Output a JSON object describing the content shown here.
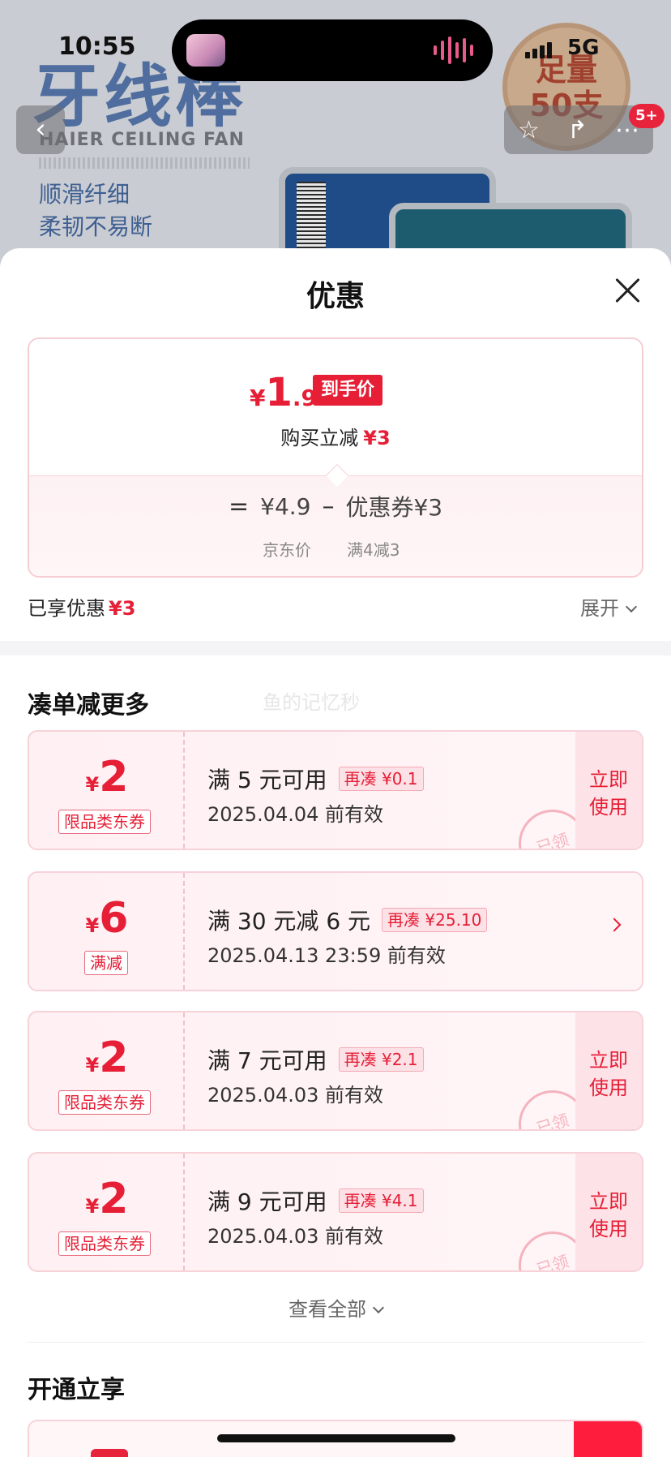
{
  "status_bar": {
    "time": "10:55",
    "network": "5G"
  },
  "product": {
    "title": "牙线棒",
    "subtitle_en": "HAIER CEILING FAN",
    "desc_lines": [
      "顺滑纤细",
      "柔韧不易断"
    ],
    "seal_text": "足量\n50支",
    "cart_badge": "5+"
  },
  "sheet": {
    "title": "优惠",
    "price_card": {
      "final_price_yen": "¥",
      "final_price_int": "1",
      "final_price_dec": ".9",
      "final_tag": "到手价",
      "instant_cut_label": "购买立减",
      "instant_cut_amount": "¥3",
      "formula_eq": "=",
      "jd_price": "¥4.9",
      "formula_minus": "–",
      "coupon_label": "优惠券¥3",
      "jd_price_caption": "京东价",
      "coupon_caption": "满4减3"
    },
    "enjoyed_label": "已享优惠",
    "enjoyed_amount": "¥3",
    "expand_label": "展开"
  },
  "section_more": {
    "title": "凑单减更多",
    "watermark": "鱼的记忆秒"
  },
  "coupons": [
    {
      "yen": "¥",
      "amount": "2",
      "type": "限品类东券",
      "condition": "满 5 元可用",
      "extra": "再凑 ¥0.1",
      "expire": "2025.04.04 前有效",
      "action": "立即\n使用",
      "stamp": "已领"
    },
    {
      "yen": "¥",
      "amount": "6",
      "type": "满减",
      "condition": "满 30 元减 6 元",
      "extra": "再凑 ¥25.10",
      "expire": "2025.04.13 23:59 前有效"
    },
    {
      "yen": "¥",
      "amount": "2",
      "type": "限品类东券",
      "condition": "满 7 元可用",
      "extra": "再凑 ¥2.1",
      "expire": "2025.04.03 前有效",
      "action": "立即\n使用",
      "stamp": "已领"
    },
    {
      "yen": "¥",
      "amount": "2",
      "type": "限品类东券",
      "condition": "满 9 元可用",
      "extra": "再凑 ¥4.1",
      "expire": "2025.04.03 前有效",
      "action": "立即\n使用",
      "stamp": "已领"
    }
  ],
  "view_all_label": "查看全部",
  "section_member": {
    "title": "开通立享"
  },
  "colors": {
    "accent": "#e61e36",
    "coupon_bg": "#fff0f3",
    "coupon_border": "#f7d2d9"
  }
}
